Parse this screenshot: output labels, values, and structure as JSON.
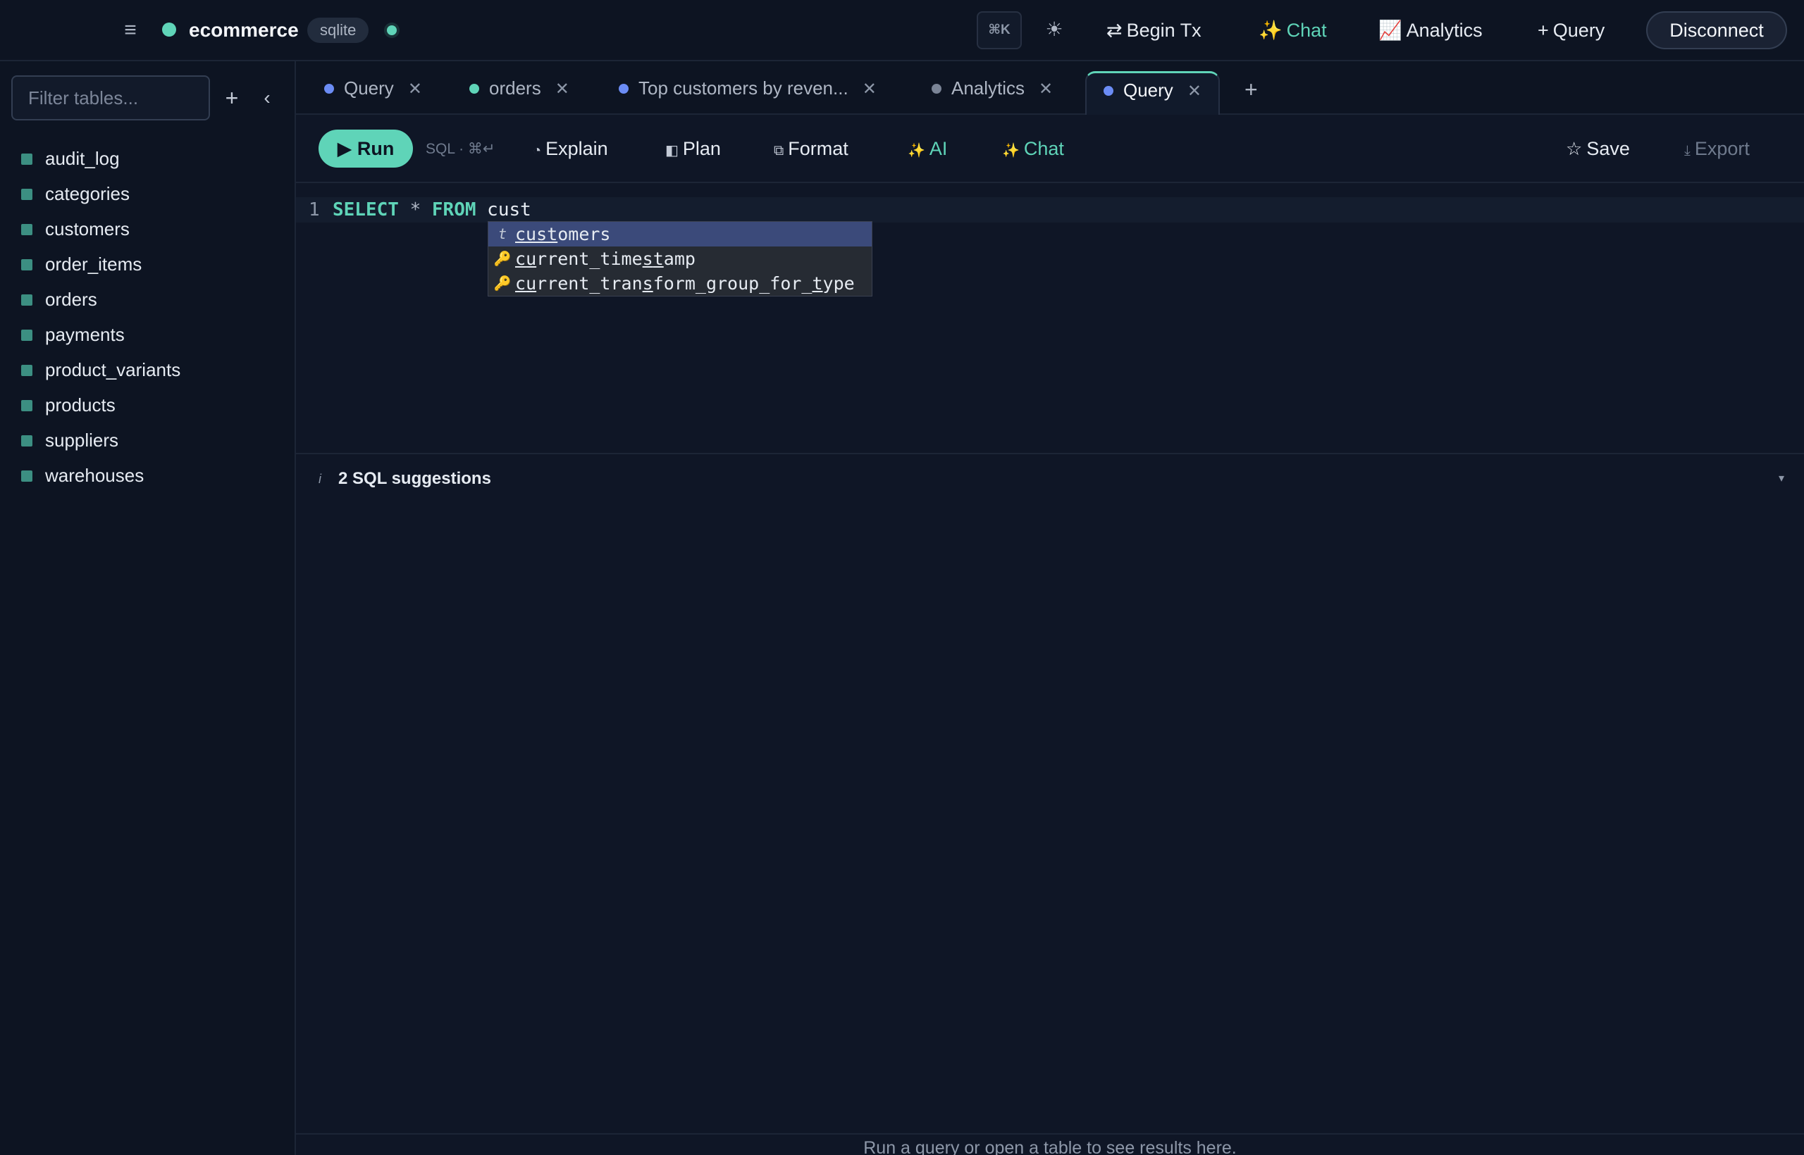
{
  "topbar": {
    "menu_icon": "hamburger-icon",
    "db_name": "ecommerce",
    "db_engine": "sqlite",
    "cmdk_label": "⌘K",
    "theme_icon": "sun-icon",
    "begin_tx": "Begin Tx",
    "chat": "Chat",
    "analytics": "Analytics",
    "new_query": "Query",
    "disconnect": "Disconnect"
  },
  "sidebar": {
    "filter_placeholder": "Filter tables...",
    "tables": [
      "audit_log",
      "categories",
      "customers",
      "order_items",
      "orders",
      "payments",
      "product_variants",
      "products",
      "suppliers",
      "warehouses"
    ]
  },
  "tabs": [
    {
      "label": "Query",
      "dot": "#6b8cf5"
    },
    {
      "label": "orders",
      "dot": "#5fd4b8"
    },
    {
      "label": "Top customers by reven...",
      "dot": "#6b8cf5"
    },
    {
      "label": "Analytics",
      "dot": "#7a8496"
    },
    {
      "label": "Query",
      "dot": "#6b8cf5",
      "active": true
    }
  ],
  "toolbar": {
    "run": "Run",
    "run_hint": "SQL · ⌘↵",
    "explain": "Explain",
    "plan": "Plan",
    "format": "Format",
    "ai": "AI",
    "chat": "Chat",
    "save": "Save",
    "export": "Export"
  },
  "editor": {
    "line_number": "1",
    "tokens": {
      "select": "SELECT",
      "star": "*",
      "from": "FROM",
      "ident": "cust"
    }
  },
  "autocomplete": {
    "items": [
      {
        "icon": "table-icon",
        "match": "cust",
        "rest": "omers"
      },
      {
        "icon": "key-icon",
        "text": "current_timestamp"
      },
      {
        "icon": "key-icon",
        "text": "current_transform_group_for_type"
      }
    ]
  },
  "suggestions": {
    "title": "2 SQL suggestions"
  },
  "results": {
    "empty_message": "Run a query or open a table to see results here."
  },
  "colors": {
    "accent": "#5fd4b8",
    "background": "#0f1626",
    "selected_suggestion": "#3b4a7a"
  }
}
